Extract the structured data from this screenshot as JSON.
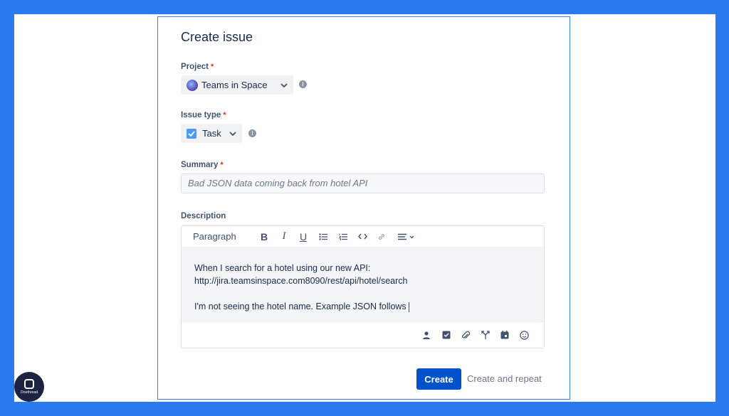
{
  "dialog": {
    "title": "Create issue"
  },
  "project": {
    "label": "Project",
    "required_mark": "*",
    "value": "Teams in Space",
    "icon": "project-avatar-icon"
  },
  "issue_type": {
    "label": "Issue type",
    "required_mark": "*",
    "value": "Task",
    "icon": "task-checkbox-icon"
  },
  "summary": {
    "label": "Summary",
    "required_mark": "*",
    "placeholder": "Bad JSON data coming back from hotel API"
  },
  "description": {
    "label": "Description",
    "toolbar": {
      "style": "Paragraph",
      "buttons": [
        "bold-icon",
        "italic-icon",
        "underline-icon",
        "bullet-list-icon",
        "numbered-list-icon",
        "code-icon",
        "link-icon",
        "align-icon"
      ]
    },
    "content": {
      "line1": "When I search for a hotel using our new API:",
      "line2": "http://jira.teamsinspace.com8090/rest/api/hotel/search",
      "line3": "I'm not seeing the hotel name. Example JSON follows"
    },
    "footer_icons": [
      "mention-icon",
      "action-item-icon",
      "attachment-icon",
      "decision-icon",
      "date-icon",
      "emoji-icon"
    ]
  },
  "actions": {
    "create": "Create",
    "create_repeat": "Create and repeat"
  },
  "brand": {
    "logo_text": "Onethread"
  },
  "colors": {
    "frame": "#2b7bf0",
    "primary": "#0052cc",
    "required": "#de350b"
  }
}
